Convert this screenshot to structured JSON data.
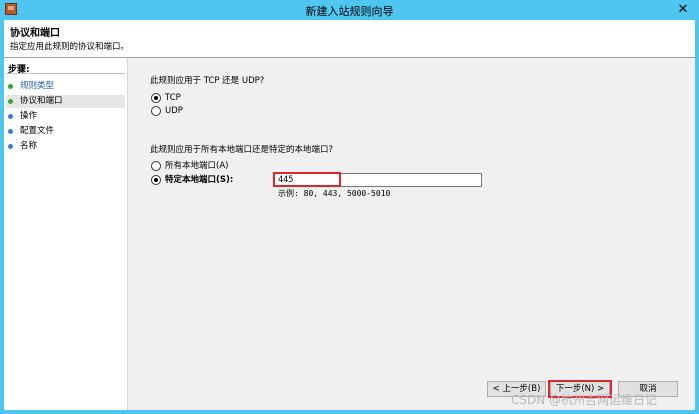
{
  "window": {
    "title": "新建入站规则向导",
    "close_symbol": "✕"
  },
  "header": {
    "title": "协议和端口",
    "subtitle": "指定应用此规则的协议和端口。"
  },
  "sidebar": {
    "title": "步骤:",
    "steps": [
      {
        "label": "规则类型"
      },
      {
        "label": "协议和端口"
      },
      {
        "label": "操作"
      },
      {
        "label": "配置文件"
      },
      {
        "label": "名称"
      }
    ]
  },
  "protocol": {
    "question": "此规则应用于 TCP 还是 UDP?",
    "options": [
      {
        "label": "TCP",
        "selected": true
      },
      {
        "label": "UDP",
        "selected": false
      }
    ]
  },
  "ports": {
    "question": "此规则应用于所有本地端口还是特定的本地端口?",
    "options": [
      {
        "label": "所有本地端口(A)",
        "selected": false
      },
      {
        "label": "特定本地端口(S):",
        "selected": true
      }
    ],
    "value": "445",
    "example": "示例: 80, 443, 5000-5010"
  },
  "buttons": {
    "back": "< 上一步(B)",
    "next": "下一步(N) >",
    "cancel": "取消"
  },
  "watermark": "CSDN @杭州吉网运维日记"
}
